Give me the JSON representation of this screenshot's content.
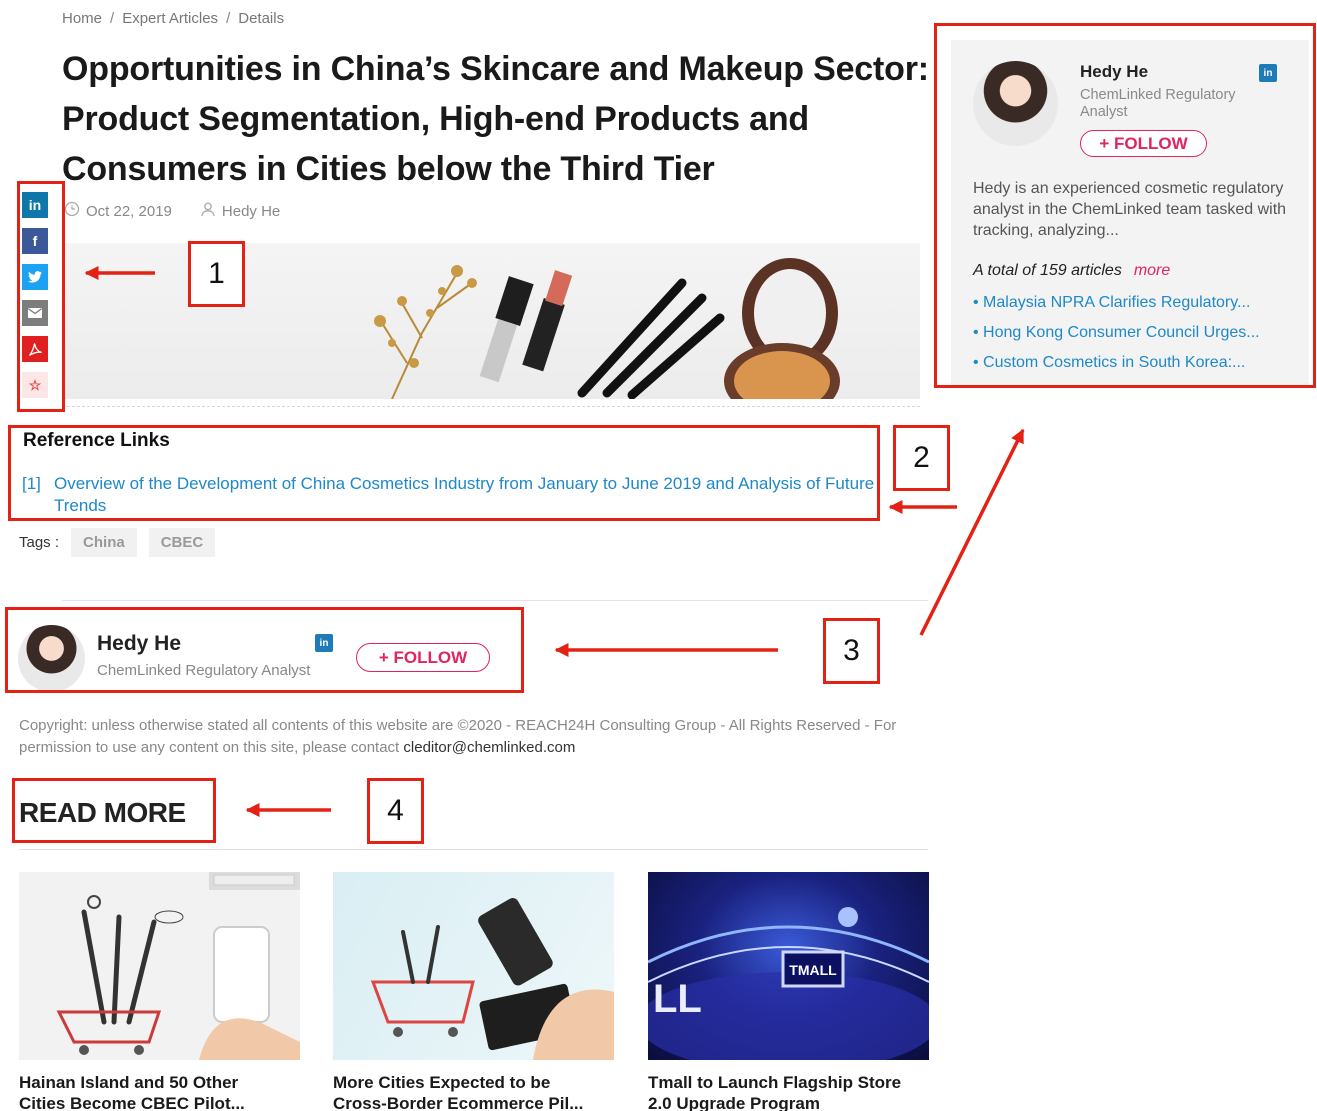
{
  "breadcrumb": {
    "home": "Home",
    "section": "Expert Articles",
    "current": "Details",
    "separator": "/"
  },
  "article": {
    "title": "Opportunities in China’s Skincare and Makeup Sector: Product Segmentation, High-end Products and Consumers in Cities below the Third Tier",
    "date": "Oct 22, 2019",
    "author": "Hedy He"
  },
  "share": {
    "linkedin": "in",
    "facebook": "f",
    "twitter_icon": "twitter-icon",
    "email_icon": "email-icon",
    "pdf_icon": "pdf-icon",
    "favorite": "☆"
  },
  "reference": {
    "heading": "Reference Links",
    "links": [
      {
        "num": "[1]",
        "text": "Overview of the Development of China Cosmetics Industry from January to June 2019 and Analysis of Future Trends"
      }
    ]
  },
  "tags": {
    "label": "Tags :",
    "items": [
      "China",
      "CBEC"
    ]
  },
  "author_row": {
    "name": "Hedy He",
    "role": "ChemLinked Regulatory Analyst",
    "linkedin": "in",
    "follow": "+ FOLLOW"
  },
  "copyright": {
    "text": "Copyright: unless otherwise stated all contents of this website are ©2020 - REACH24H Consulting Group - All Rights Reserved - For permission to use any content on this site, please contact ",
    "email": "cleditor@chemlinked.com"
  },
  "read_more": {
    "heading": "READ MORE",
    "cards": [
      {
        "title_line1": "Hainan Island and 50 Other",
        "title_line2": "Cities Become CBEC Pilot..."
      },
      {
        "title_line1": "More Cities Expected to be",
        "title_line2": "Cross-Border Ecommerce Pil..."
      },
      {
        "title_line1": "Tmall to Launch Flagship Store",
        "title_line2": "2.0 Upgrade Program"
      }
    ],
    "tmall_sign": "TMALL"
  },
  "side_card": {
    "name": "Hedy He",
    "role": "ChemLinked Regulatory Analyst",
    "linkedin": "in",
    "follow": "+ FOLLOW",
    "bio": "Hedy is an experienced cosmetic regulatory analyst in the ChemLinked team tasked with tracking, analyzing...",
    "total": "A total of 159 articles",
    "more": "more",
    "articles": [
      "• Malaysia NPRA Clarifies Regulatory...",
      "• Hong Kong Consumer Council Urges...",
      "• Custom Cosmetics in South Korea:..."
    ]
  },
  "annotations": {
    "n1": "1",
    "n2": "2",
    "n3": "3",
    "n4": "4"
  },
  "colors": {
    "accent_red": "#e32114",
    "link_blue": "#1e88c9",
    "follow_pink": "#e0245e"
  }
}
